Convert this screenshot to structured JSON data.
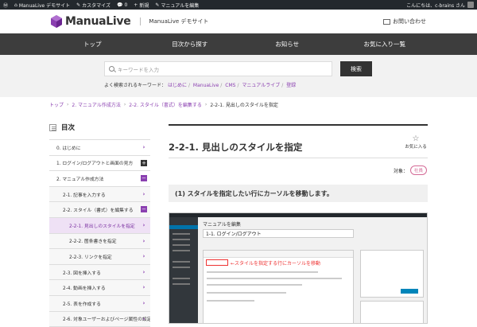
{
  "adminbar": {
    "site": "ManuaLive デモサイト",
    "customize": "カスタマイズ",
    "comments": "0",
    "new": "新規",
    "edit": "マニュアルを編集",
    "greeting": "こんにちは、c-brains さん"
  },
  "header": {
    "logo": "ManuaLive",
    "site_name": "ManuaLive デモサイト",
    "contact": "お問い合わせ"
  },
  "nav": [
    "トップ",
    "目次から探す",
    "お知らせ",
    "お気に入り一覧"
  ],
  "search": {
    "placeholder": "キーワードを入力",
    "button": "検索",
    "popular_label": "よく検索されるキーワード：",
    "popular": [
      "はじめに",
      "ManuaLive",
      "CMS",
      "マニュアルライブ",
      "登録"
    ]
  },
  "breadcrumb": {
    "home": "トップ",
    "l1": "2. マニュアル作成方法",
    "l2": "2-2. スタイル（書式）を編集する",
    "current": "2-2-1. 見出しのスタイルを指定"
  },
  "toc": {
    "title": "目次",
    "items": [
      {
        "label": "0. はじめに",
        "mark": "›"
      },
      {
        "label": "1. ログイン/ログアウトと画面の見方",
        "mark": "+"
      },
      {
        "label": "2. マニュアル作成方法",
        "mark": "−"
      },
      {
        "label": "2-1. 記事を入力する",
        "mark": "›"
      },
      {
        "label": "2-2. スタイル（書式）を編集する",
        "mark": "−"
      },
      {
        "label": "2-2-1. 見出しのスタイルを指定",
        "mark": "›"
      },
      {
        "label": "2-2-2. 箇条書きを指定",
        "mark": "›"
      },
      {
        "label": "2-2-3. リンクを指定",
        "mark": "›"
      },
      {
        "label": "2-3. 図を挿入する",
        "mark": "›"
      },
      {
        "label": "2-4. 動画を挿入する",
        "mark": "›"
      },
      {
        "label": "2-5. 表を作成する",
        "mark": "›"
      },
      {
        "label": "2-6. 対象ユーザーおよびページ属性の設定",
        "mark": "›"
      }
    ]
  },
  "main": {
    "title": "2-2-1. 見出しのスタイルを指定",
    "favorite": "お気に入る",
    "target_label": "対象：",
    "target_badge": "社員",
    "step": "(1) スタイルを指定したい行にカーソルを移動します。"
  },
  "screenshot": {
    "heading": "マニュアルを編集",
    "post_title": "1-1. ログイン/ログアウト",
    "note": "←スタイルを指定する行にカーソルを移動"
  }
}
